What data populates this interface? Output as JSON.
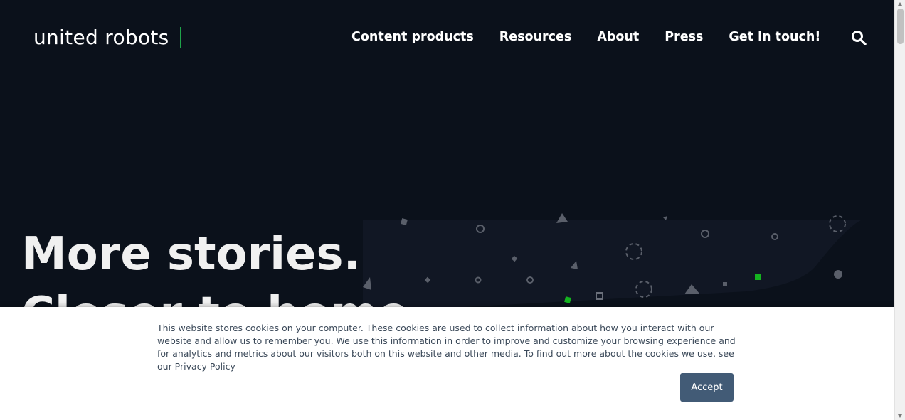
{
  "header": {
    "logo": "united robots",
    "nav": [
      "Content products",
      "Resources",
      "About",
      "Press",
      "Get in touch!"
    ],
    "search_icon": "search-icon"
  },
  "hero": {
    "line1": "More stories.",
    "line2": "Closer to home."
  },
  "cookie_banner": {
    "text": "This website stores cookies on your computer. These cookies are used to collect information about how you interact with our website and allow us to remember you. We use this information in order to improve and customize your browsing experience and for analytics and metrics about our visitors both on this website and other media. To find out more about the cookies we use, see our Privacy Policy",
    "accept_label": "Accept"
  },
  "colors": {
    "background": "#0b111b",
    "accent_green": "#1fa34a",
    "button": "#425b76"
  }
}
